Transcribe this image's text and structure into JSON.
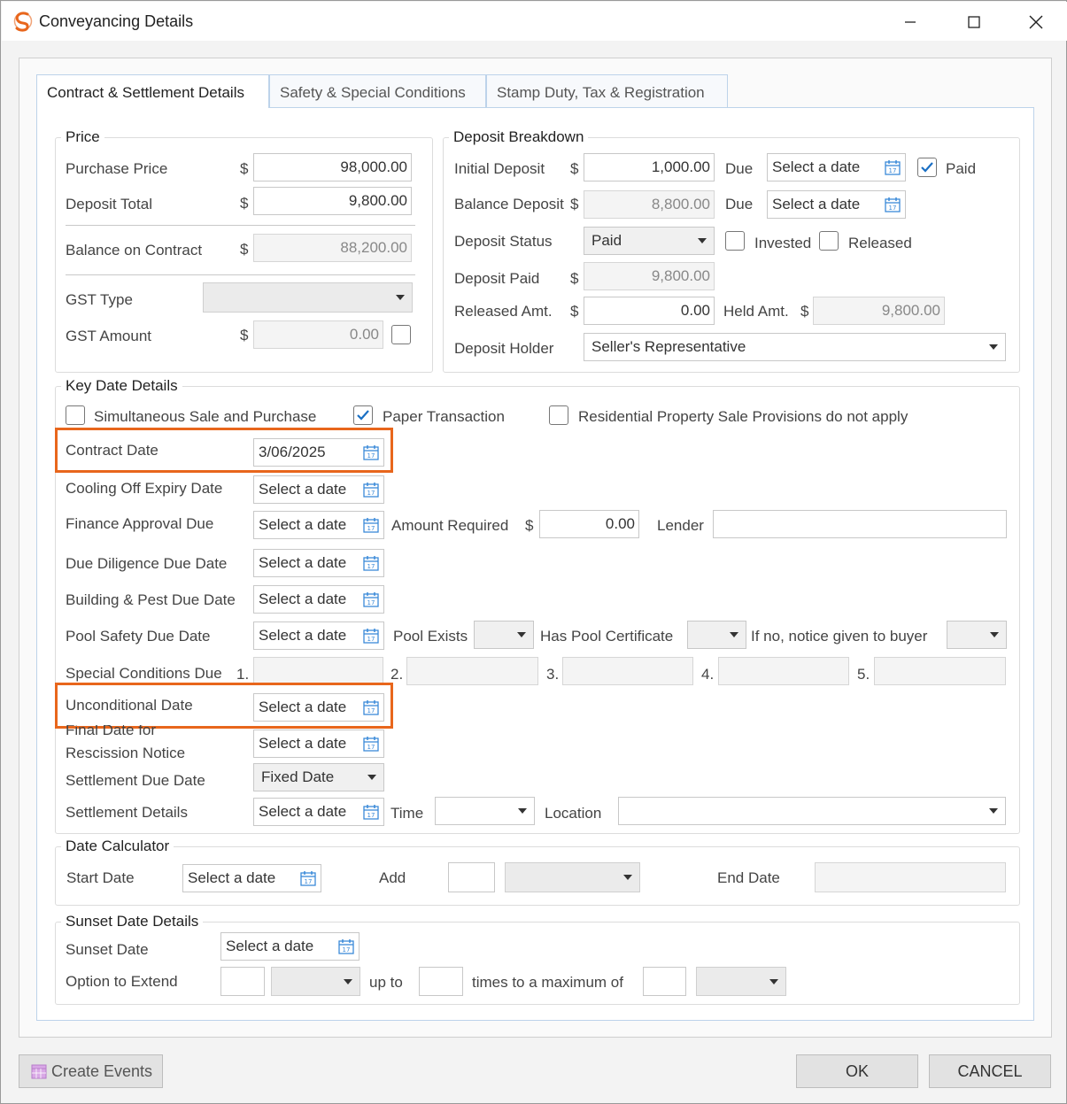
{
  "window": {
    "title": "Conveyancing Details"
  },
  "tabs": [
    {
      "label": "Contract & Settlement Details"
    },
    {
      "label": "Safety & Special Conditions"
    },
    {
      "label": "Stamp Duty, Tax & Registration"
    }
  ],
  "price": {
    "title": "Price",
    "purchase_price_label": "Purchase Price",
    "purchase_price": "98,000.00",
    "deposit_total_label": "Deposit Total",
    "deposit_total": "9,800.00",
    "balance_label": "Balance on Contract",
    "balance": "88,200.00",
    "gst_type_label": "GST Type",
    "gst_amount_label": "GST Amount",
    "gst_amount": "0.00",
    "currency": "$"
  },
  "deposit": {
    "title": "Deposit Breakdown",
    "initial_label": "Initial Deposit",
    "initial_value": "1,000.00",
    "due_label": "Due",
    "date_placeholder": "Select a date",
    "paid_label": "Paid",
    "balance_label": "Balance Deposit",
    "balance_value": "8,800.00",
    "status_label": "Deposit Status",
    "status_value": "Paid",
    "invested_label": "Invested",
    "released_label": "Released",
    "paid_amt_label": "Deposit Paid",
    "paid_amt_value": "9,800.00",
    "released_amt_label": "Released Amt.",
    "released_amt_value": "0.00",
    "held_label": "Held Amt.",
    "held_value": "9,800.00",
    "holder_label": "Deposit Holder",
    "holder_value": "Seller's Representative"
  },
  "key_dates": {
    "title": "Key Date Details",
    "simultaneous_label": "Simultaneous Sale and Purchase",
    "paper_label": "Paper Transaction",
    "residential_label": "Residential Property Sale Provisions do not apply",
    "contract_date_label": "Contract Date",
    "contract_date_value": "3/06/2025",
    "cooling_label": "Cooling Off Expiry Date",
    "finance_label": "Finance Approval Due",
    "amount_required_label": "Amount Required",
    "amount_required_value": "0.00",
    "lender_label": "Lender",
    "due_diligence_label": "Due Diligence Due Date",
    "building_label": "Building & Pest Due Date",
    "pool_label": "Pool Safety Due Date",
    "pool_exists_label": "Pool Exists",
    "pool_cert_label": "Has Pool Certificate",
    "pool_notice_label": "If no, notice given to buyer",
    "special_label": "Special Conditions Due",
    "special_nums": [
      "1.",
      "2.",
      "3.",
      "4.",
      "5."
    ],
    "unconditional_label": "Unconditional Date",
    "rescission_label_1": "Final Date for",
    "rescission_label_2": "Rescission Notice",
    "settlement_due_label": "Settlement Due Date",
    "settlement_due_value": "Fixed Date",
    "settlement_details_label": "Settlement Details",
    "time_label": "Time",
    "location_label": "Location",
    "placeholder": "Select a date"
  },
  "calculator": {
    "title": "Date Calculator",
    "start_label": "Start Date",
    "add_label": "Add",
    "end_label": "End Date",
    "placeholder": "Select a date"
  },
  "sunset": {
    "title": "Sunset Date Details",
    "sunset_label": "Sunset Date",
    "option_label": "Option to Extend",
    "upto_label": "up to",
    "times_label": "times to a maximum of",
    "placeholder": "Select a date"
  },
  "footer": {
    "create_events": "Create Events",
    "ok": "OK",
    "cancel": "CANCEL"
  },
  "colors": {
    "accent": "#e8661c",
    "check": "#1a6fc4",
    "calendar": "#3b8ad8"
  }
}
